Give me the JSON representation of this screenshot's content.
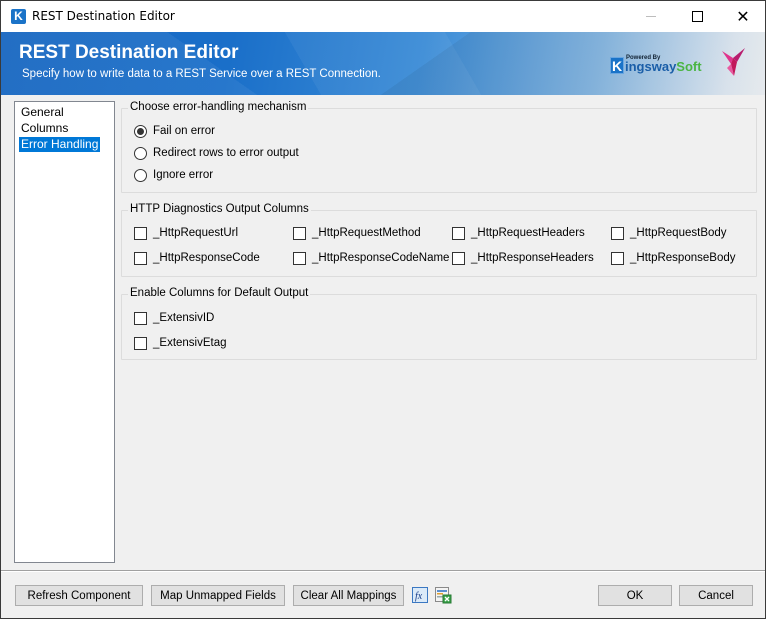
{
  "window": {
    "title": "REST Destination Editor",
    "controls": {
      "minimize": "minimize",
      "maximize": "maximize",
      "close": "close"
    }
  },
  "banner": {
    "title": "REST Destination Editor",
    "subtitle": "Specify how to write data to a REST Service over a REST Connection.",
    "logo": {
      "k_letter": "K",
      "powered_by": "Powered By",
      "brand_part1": "ingsway",
      "brand_part2": "Soft"
    }
  },
  "nav": {
    "items": [
      {
        "label": "General",
        "selected": false
      },
      {
        "label": "Columns",
        "selected": false
      },
      {
        "label": "Error Handling",
        "selected": true
      }
    ]
  },
  "error_handling": {
    "label": "Choose error-handling mechanism",
    "options": [
      {
        "label": "Fail on error",
        "checked": true
      },
      {
        "label": "Redirect rows to error output",
        "checked": false
      },
      {
        "label": "Ignore error",
        "checked": false
      }
    ]
  },
  "http_diagnostics": {
    "label": "HTTP Diagnostics Output Columns",
    "columns": [
      {
        "label": "_HttpRequestUrl",
        "checked": false
      },
      {
        "label": "_HttpRequestMethod",
        "checked": false
      },
      {
        "label": "_HttpRequestHeaders",
        "checked": false
      },
      {
        "label": "_HttpRequestBody",
        "checked": false
      },
      {
        "label": "_HttpResponseCode",
        "checked": false
      },
      {
        "label": "_HttpResponseCodeName",
        "checked": false
      },
      {
        "label": "_HttpResponseHeaders",
        "checked": false
      },
      {
        "label": "_HttpResponseBody",
        "checked": false
      }
    ]
  },
  "default_output": {
    "label": "Enable Columns for Default Output",
    "columns": [
      {
        "label": "_ExtensivID",
        "checked": false
      },
      {
        "label": "_ExtensivEtag",
        "checked": false
      }
    ]
  },
  "footer": {
    "refresh": "Refresh Component",
    "map_unmapped": "Map Unmapped Fields",
    "clear_all": "Clear All Mappings",
    "fx_icon": "fx",
    "ok": "OK",
    "cancel": "Cancel"
  },
  "colors": {
    "selection": "#0078d7",
    "banner_blue": "#1565c0",
    "brand_green": "#4bb543",
    "brand_pink": "#d6237f"
  }
}
